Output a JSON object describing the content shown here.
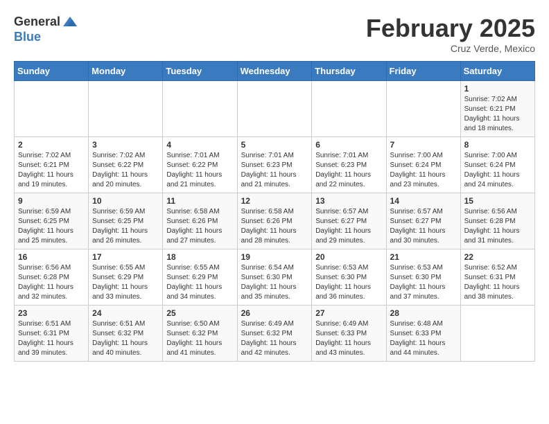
{
  "logo": {
    "general": "General",
    "blue": "Blue"
  },
  "title": {
    "month": "February 2025",
    "location": "Cruz Verde, Mexico"
  },
  "calendar": {
    "headers": [
      "Sunday",
      "Monday",
      "Tuesday",
      "Wednesday",
      "Thursday",
      "Friday",
      "Saturday"
    ],
    "weeks": [
      [
        {
          "day": "",
          "info": ""
        },
        {
          "day": "",
          "info": ""
        },
        {
          "day": "",
          "info": ""
        },
        {
          "day": "",
          "info": ""
        },
        {
          "day": "",
          "info": ""
        },
        {
          "day": "",
          "info": ""
        },
        {
          "day": "1",
          "info": "Sunrise: 7:02 AM\nSunset: 6:21 PM\nDaylight: 11 hours\nand 18 minutes."
        }
      ],
      [
        {
          "day": "2",
          "info": "Sunrise: 7:02 AM\nSunset: 6:21 PM\nDaylight: 11 hours\nand 19 minutes."
        },
        {
          "day": "3",
          "info": "Sunrise: 7:02 AM\nSunset: 6:22 PM\nDaylight: 11 hours\nand 20 minutes."
        },
        {
          "day": "4",
          "info": "Sunrise: 7:01 AM\nSunset: 6:22 PM\nDaylight: 11 hours\nand 21 minutes."
        },
        {
          "day": "5",
          "info": "Sunrise: 7:01 AM\nSunset: 6:23 PM\nDaylight: 11 hours\nand 21 minutes."
        },
        {
          "day": "6",
          "info": "Sunrise: 7:01 AM\nSunset: 6:23 PM\nDaylight: 11 hours\nand 22 minutes."
        },
        {
          "day": "7",
          "info": "Sunrise: 7:00 AM\nSunset: 6:24 PM\nDaylight: 11 hours\nand 23 minutes."
        },
        {
          "day": "8",
          "info": "Sunrise: 7:00 AM\nSunset: 6:24 PM\nDaylight: 11 hours\nand 24 minutes."
        }
      ],
      [
        {
          "day": "9",
          "info": "Sunrise: 6:59 AM\nSunset: 6:25 PM\nDaylight: 11 hours\nand 25 minutes."
        },
        {
          "day": "10",
          "info": "Sunrise: 6:59 AM\nSunset: 6:25 PM\nDaylight: 11 hours\nand 26 minutes."
        },
        {
          "day": "11",
          "info": "Sunrise: 6:58 AM\nSunset: 6:26 PM\nDaylight: 11 hours\nand 27 minutes."
        },
        {
          "day": "12",
          "info": "Sunrise: 6:58 AM\nSunset: 6:26 PM\nDaylight: 11 hours\nand 28 minutes."
        },
        {
          "day": "13",
          "info": "Sunrise: 6:57 AM\nSunset: 6:27 PM\nDaylight: 11 hours\nand 29 minutes."
        },
        {
          "day": "14",
          "info": "Sunrise: 6:57 AM\nSunset: 6:27 PM\nDaylight: 11 hours\nand 30 minutes."
        },
        {
          "day": "15",
          "info": "Sunrise: 6:56 AM\nSunset: 6:28 PM\nDaylight: 11 hours\nand 31 minutes."
        }
      ],
      [
        {
          "day": "16",
          "info": "Sunrise: 6:56 AM\nSunset: 6:28 PM\nDaylight: 11 hours\nand 32 minutes."
        },
        {
          "day": "17",
          "info": "Sunrise: 6:55 AM\nSunset: 6:29 PM\nDaylight: 11 hours\nand 33 minutes."
        },
        {
          "day": "18",
          "info": "Sunrise: 6:55 AM\nSunset: 6:29 PM\nDaylight: 11 hours\nand 34 minutes."
        },
        {
          "day": "19",
          "info": "Sunrise: 6:54 AM\nSunset: 6:30 PM\nDaylight: 11 hours\nand 35 minutes."
        },
        {
          "day": "20",
          "info": "Sunrise: 6:53 AM\nSunset: 6:30 PM\nDaylight: 11 hours\nand 36 minutes."
        },
        {
          "day": "21",
          "info": "Sunrise: 6:53 AM\nSunset: 6:30 PM\nDaylight: 11 hours\nand 37 minutes."
        },
        {
          "day": "22",
          "info": "Sunrise: 6:52 AM\nSunset: 6:31 PM\nDaylight: 11 hours\nand 38 minutes."
        }
      ],
      [
        {
          "day": "23",
          "info": "Sunrise: 6:51 AM\nSunset: 6:31 PM\nDaylight: 11 hours\nand 39 minutes."
        },
        {
          "day": "24",
          "info": "Sunrise: 6:51 AM\nSunset: 6:32 PM\nDaylight: 11 hours\nand 40 minutes."
        },
        {
          "day": "25",
          "info": "Sunrise: 6:50 AM\nSunset: 6:32 PM\nDaylight: 11 hours\nand 41 minutes."
        },
        {
          "day": "26",
          "info": "Sunrise: 6:49 AM\nSunset: 6:32 PM\nDaylight: 11 hours\nand 42 minutes."
        },
        {
          "day": "27",
          "info": "Sunrise: 6:49 AM\nSunset: 6:33 PM\nDaylight: 11 hours\nand 43 minutes."
        },
        {
          "day": "28",
          "info": "Sunrise: 6:48 AM\nSunset: 6:33 PM\nDaylight: 11 hours\nand 44 minutes."
        },
        {
          "day": "",
          "info": ""
        }
      ]
    ]
  }
}
